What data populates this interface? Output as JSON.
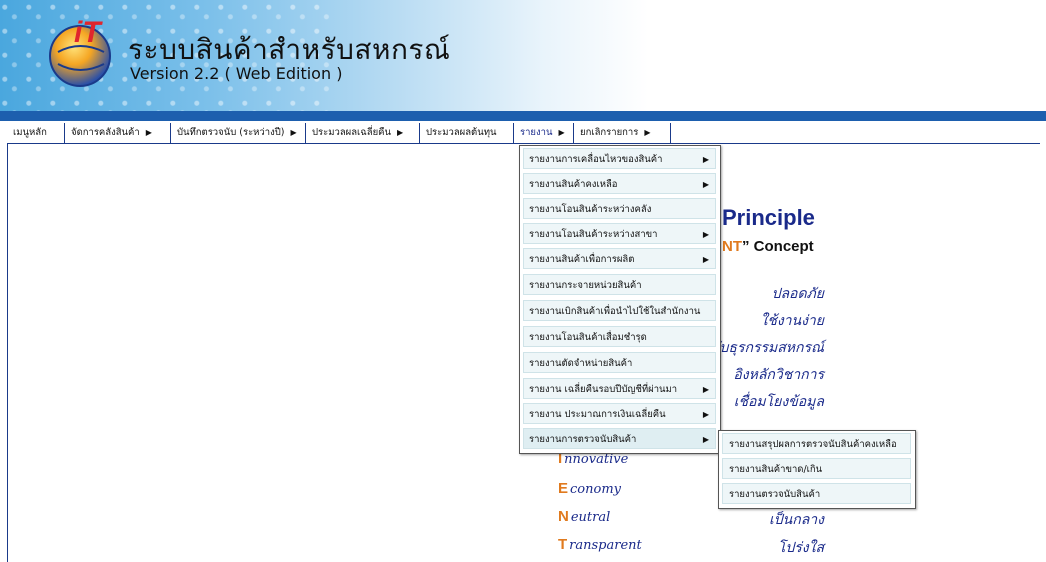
{
  "header": {
    "title": "ระบบสินค้าสำหรับสหกรณ์",
    "version": "Version 2.2 ( Web Edition )"
  },
  "menubar": {
    "items": [
      {
        "label": "เมนูหลัก"
      },
      {
        "label": "จัดการคลังสินค้า",
        "arrow": "▶"
      },
      {
        "label": "บันทึกตรวจนับ (ระหว่างปี)",
        "arrow": "▶"
      },
      {
        "label": "ประมวลผลเฉลี่ยคืน",
        "arrow": "▶"
      },
      {
        "label": "ประมวลผลต้นทุน"
      },
      {
        "label": "รายงาน",
        "arrow": "▶"
      },
      {
        "label": "ยกเลิกรายการ",
        "arrow": "▶"
      }
    ]
  },
  "report_menu": {
    "items": [
      {
        "label": "รายงานการเคลื่อนไหวของสินค้า",
        "arrow": "▶"
      },
      {
        "label": "รายงานสินค้าคงเหลือ",
        "arrow": "▶"
      },
      {
        "label": "รายงานโอนสินค้าระหว่างคลัง"
      },
      {
        "label": "รายงานโอนสินค้าระหว่างสาขา",
        "arrow": "▶"
      },
      {
        "label": "รายงานสินค้าเพื่อการผลิต",
        "arrow": "▶"
      },
      {
        "label": "รายงานกระจายหน่วยสินค้า"
      },
      {
        "label": "รายงานเบิกสินค้าเพื่อนำไปใช้ในสำนักงาน"
      },
      {
        "label": "รายงานโอนสินค้าเสื่อมชำรุด"
      },
      {
        "label": "รายงานตัดจำหน่ายสินค้า"
      },
      {
        "label": "รายงาน เฉลี่ยคืนรอบปีบัญชีที่ผ่านมา",
        "arrow": "▶"
      },
      {
        "label": "รายงาน ประมาณการเงินเฉลี่ยคืน",
        "arrow": "▶"
      },
      {
        "label": "รายงานการตรวจนับสินค้า",
        "arrow": "▶"
      }
    ]
  },
  "count_submenu": {
    "items": [
      {
        "label": "รายงานสรุปผลการตรวจนับสินค้าคงเหลือ"
      },
      {
        "label": "รายงานสินค้าขาด/เกิน"
      },
      {
        "label": "รายงานตรวจนับสินค้า"
      }
    ]
  },
  "background": {
    "principle": "Principle",
    "concept_nt": "NT",
    "concept_rest": "” Concept",
    "thai_lines": [
      "ปลอดภัย",
      "ใช้งานง่าย",
      "รับธุรกรรมสหกรณ์",
      "อิงหลักวิชาการ",
      "เชื่อมโยงข้อมูล"
    ],
    "acronym": [
      {
        "cap": "I",
        "rest": "nnovative"
      },
      {
        "cap": "E",
        "rest": "conomy"
      },
      {
        "cap": "N",
        "rest": "eutral",
        "thai": "เป็นกลาง"
      },
      {
        "cap": "T",
        "rest": "ransparent",
        "thai": "โปร่งใส"
      }
    ]
  },
  "colors": {
    "accent_blue": "#1d5fae",
    "orange": "#e07a1e",
    "navy": "#1a2a8a"
  },
  "icons": {
    "logo": "it-globe-logo",
    "arrow": "triangle-right-icon"
  }
}
